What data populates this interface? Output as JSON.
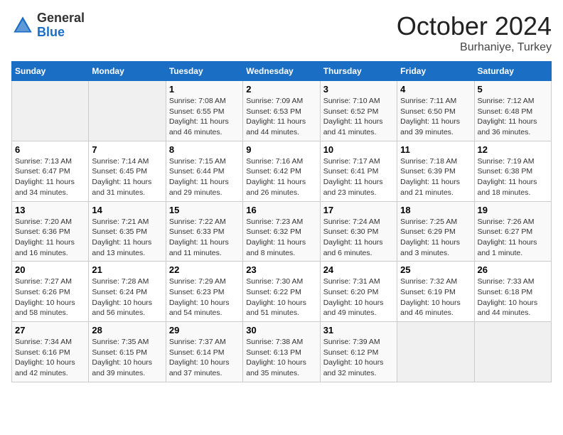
{
  "header": {
    "logo_general": "General",
    "logo_blue": "Blue",
    "month_title": "October 2024",
    "subtitle": "Burhaniye, Turkey"
  },
  "weekdays": [
    "Sunday",
    "Monday",
    "Tuesday",
    "Wednesday",
    "Thursday",
    "Friday",
    "Saturday"
  ],
  "weeks": [
    [
      {
        "day": "",
        "info": ""
      },
      {
        "day": "",
        "info": ""
      },
      {
        "day": "1",
        "info": "Sunrise: 7:08 AM\nSunset: 6:55 PM\nDaylight: 11 hours and 46 minutes."
      },
      {
        "day": "2",
        "info": "Sunrise: 7:09 AM\nSunset: 6:53 PM\nDaylight: 11 hours and 44 minutes."
      },
      {
        "day": "3",
        "info": "Sunrise: 7:10 AM\nSunset: 6:52 PM\nDaylight: 11 hours and 41 minutes."
      },
      {
        "day": "4",
        "info": "Sunrise: 7:11 AM\nSunset: 6:50 PM\nDaylight: 11 hours and 39 minutes."
      },
      {
        "day": "5",
        "info": "Sunrise: 7:12 AM\nSunset: 6:48 PM\nDaylight: 11 hours and 36 minutes."
      }
    ],
    [
      {
        "day": "6",
        "info": "Sunrise: 7:13 AM\nSunset: 6:47 PM\nDaylight: 11 hours and 34 minutes."
      },
      {
        "day": "7",
        "info": "Sunrise: 7:14 AM\nSunset: 6:45 PM\nDaylight: 11 hours and 31 minutes."
      },
      {
        "day": "8",
        "info": "Sunrise: 7:15 AM\nSunset: 6:44 PM\nDaylight: 11 hours and 29 minutes."
      },
      {
        "day": "9",
        "info": "Sunrise: 7:16 AM\nSunset: 6:42 PM\nDaylight: 11 hours and 26 minutes."
      },
      {
        "day": "10",
        "info": "Sunrise: 7:17 AM\nSunset: 6:41 PM\nDaylight: 11 hours and 23 minutes."
      },
      {
        "day": "11",
        "info": "Sunrise: 7:18 AM\nSunset: 6:39 PM\nDaylight: 11 hours and 21 minutes."
      },
      {
        "day": "12",
        "info": "Sunrise: 7:19 AM\nSunset: 6:38 PM\nDaylight: 11 hours and 18 minutes."
      }
    ],
    [
      {
        "day": "13",
        "info": "Sunrise: 7:20 AM\nSunset: 6:36 PM\nDaylight: 11 hours and 16 minutes."
      },
      {
        "day": "14",
        "info": "Sunrise: 7:21 AM\nSunset: 6:35 PM\nDaylight: 11 hours and 13 minutes."
      },
      {
        "day": "15",
        "info": "Sunrise: 7:22 AM\nSunset: 6:33 PM\nDaylight: 11 hours and 11 minutes."
      },
      {
        "day": "16",
        "info": "Sunrise: 7:23 AM\nSunset: 6:32 PM\nDaylight: 11 hours and 8 minutes."
      },
      {
        "day": "17",
        "info": "Sunrise: 7:24 AM\nSunset: 6:30 PM\nDaylight: 11 hours and 6 minutes."
      },
      {
        "day": "18",
        "info": "Sunrise: 7:25 AM\nSunset: 6:29 PM\nDaylight: 11 hours and 3 minutes."
      },
      {
        "day": "19",
        "info": "Sunrise: 7:26 AM\nSunset: 6:27 PM\nDaylight: 11 hours and 1 minute."
      }
    ],
    [
      {
        "day": "20",
        "info": "Sunrise: 7:27 AM\nSunset: 6:26 PM\nDaylight: 10 hours and 58 minutes."
      },
      {
        "day": "21",
        "info": "Sunrise: 7:28 AM\nSunset: 6:24 PM\nDaylight: 10 hours and 56 minutes."
      },
      {
        "day": "22",
        "info": "Sunrise: 7:29 AM\nSunset: 6:23 PM\nDaylight: 10 hours and 54 minutes."
      },
      {
        "day": "23",
        "info": "Sunrise: 7:30 AM\nSunset: 6:22 PM\nDaylight: 10 hours and 51 minutes."
      },
      {
        "day": "24",
        "info": "Sunrise: 7:31 AM\nSunset: 6:20 PM\nDaylight: 10 hours and 49 minutes."
      },
      {
        "day": "25",
        "info": "Sunrise: 7:32 AM\nSunset: 6:19 PM\nDaylight: 10 hours and 46 minutes."
      },
      {
        "day": "26",
        "info": "Sunrise: 7:33 AM\nSunset: 6:18 PM\nDaylight: 10 hours and 44 minutes."
      }
    ],
    [
      {
        "day": "27",
        "info": "Sunrise: 7:34 AM\nSunset: 6:16 PM\nDaylight: 10 hours and 42 minutes."
      },
      {
        "day": "28",
        "info": "Sunrise: 7:35 AM\nSunset: 6:15 PM\nDaylight: 10 hours and 39 minutes."
      },
      {
        "day": "29",
        "info": "Sunrise: 7:37 AM\nSunset: 6:14 PM\nDaylight: 10 hours and 37 minutes."
      },
      {
        "day": "30",
        "info": "Sunrise: 7:38 AM\nSunset: 6:13 PM\nDaylight: 10 hours and 35 minutes."
      },
      {
        "day": "31",
        "info": "Sunrise: 7:39 AM\nSunset: 6:12 PM\nDaylight: 10 hours and 32 minutes."
      },
      {
        "day": "",
        "info": ""
      },
      {
        "day": "",
        "info": ""
      }
    ]
  ]
}
